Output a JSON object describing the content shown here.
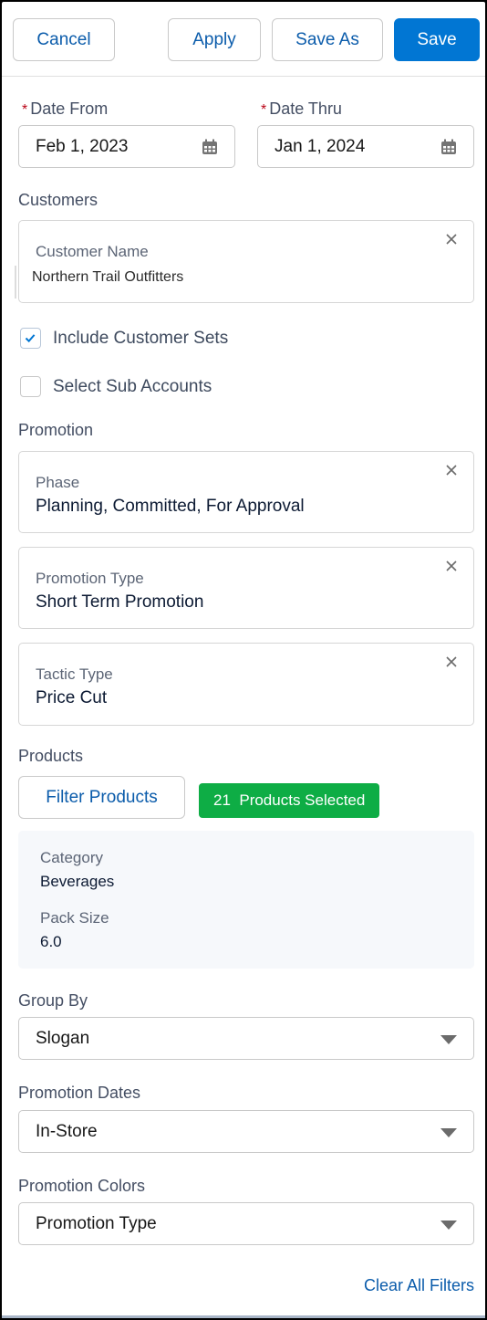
{
  "toolbar": {
    "cancel_label": "Cancel",
    "apply_label": "Apply",
    "save_as_label": "Save As",
    "save_label": "Save"
  },
  "dates": {
    "required_marker": "*",
    "from": {
      "label": "Date From",
      "value": "Feb 1, 2023",
      "icon": "calendar-icon"
    },
    "thru": {
      "label": "Date Thru",
      "value": "Jan 1, 2024",
      "icon": "calendar-icon"
    }
  },
  "customers": {
    "section_label": "Customers",
    "filter": {
      "label": "Customer Name",
      "value": "Northern Trail Outfitters",
      "icon": "close-icon"
    },
    "include_customer_sets": {
      "label": "Include Customer Sets",
      "checked": true
    },
    "select_sub_accounts": {
      "label": "Select Sub Accounts",
      "checked": false
    }
  },
  "promotion": {
    "section_label": "Promotion",
    "filters": [
      {
        "label": "Phase",
        "value": "Planning, Committed, For Approval"
      },
      {
        "label": "Promotion Type",
        "value": "Short Term Promotion"
      },
      {
        "label": "Tactic Type",
        "value": "Price Cut"
      }
    ]
  },
  "products": {
    "section_label": "Products",
    "filter_button_label": "Filter Products",
    "selected_badge": "21  Products Selected",
    "selected_count": 21,
    "badge_color": "#0ead45",
    "summary": [
      {
        "label": "Category",
        "value": "Beverages"
      },
      {
        "label": "Pack Size",
        "value": "6.0"
      }
    ]
  },
  "group_by": {
    "label": "Group By",
    "value": "Slogan"
  },
  "promotion_dates": {
    "label": "Promotion Dates",
    "value": "In-Store"
  },
  "promotion_colors": {
    "label": "Promotion Colors",
    "value": "Promotion Type"
  },
  "footer": {
    "clear_all_label": "Clear All Filters"
  },
  "colors": {
    "brand": "#0176d3",
    "link": "#0b5cab",
    "required": "#ba0517"
  }
}
